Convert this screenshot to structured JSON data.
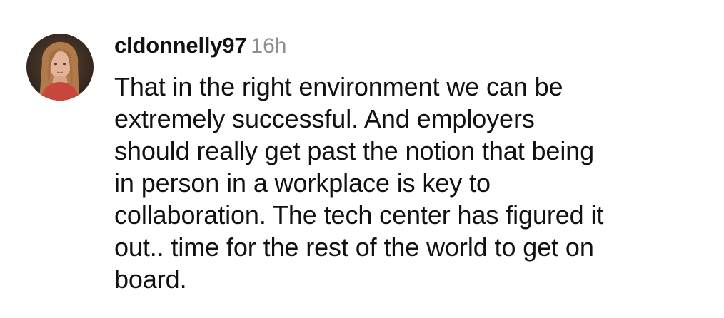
{
  "comment": {
    "username": "cldonnelly97",
    "timestamp": "16h",
    "avatar_icon": "profile-photo",
    "text_lines": [
      "That in the right environment we can be",
      "extremely successful. And employers",
      "should really get past the notion that being",
      "in person in a workplace is key to",
      "collaboration. The tech center has figured it",
      "out.. time for the rest of the world to get on",
      "board."
    ]
  }
}
